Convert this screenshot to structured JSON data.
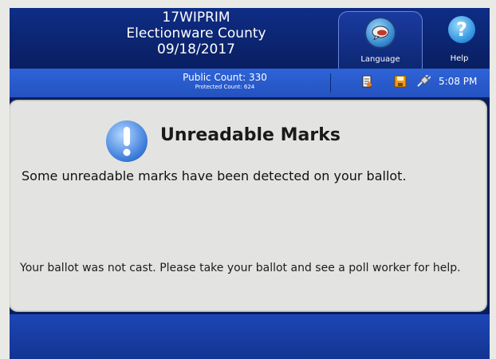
{
  "header": {
    "election_code": "17WIPRIM",
    "county": "Electionware County",
    "date": "09/18/2017",
    "language_label": "Language",
    "help_label": "Help",
    "help_glyph": "?"
  },
  "status_bar": {
    "public_count": "Public Count: 330",
    "protected_count": "Protected Count: 624",
    "time": "5:08 PM",
    "icons": [
      "document-icon",
      "save-icon",
      "plug-icon"
    ]
  },
  "message": {
    "title": "Unreadable Marks",
    "body": "Some unreadable marks have been detected on your ballot.",
    "instruction": "Your ballot was not cast. Please take your ballot and see a poll worker for help.",
    "icon": "exclamation-icon"
  },
  "colors": {
    "header_bg": "#0e2d86",
    "status_bar_bg": "#2e63d8",
    "panel_bg": "#e3e4e1",
    "accent_blue": "#3f7fdc"
  }
}
